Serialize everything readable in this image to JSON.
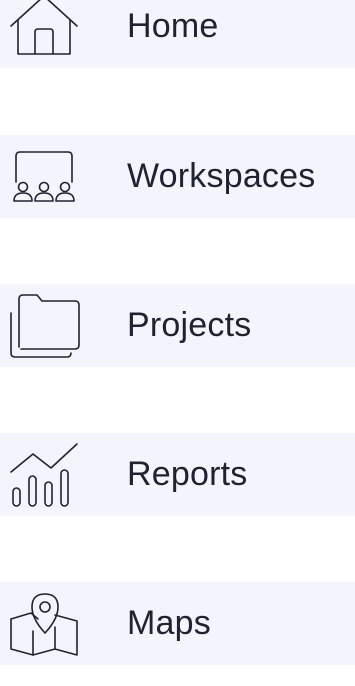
{
  "nav": {
    "background": "#f4f4fd",
    "text_color": "#1f2230",
    "items": [
      {
        "label": "Home",
        "icon": "home-icon"
      },
      {
        "label": "Workspaces",
        "icon": "workspaces-icon"
      },
      {
        "label": "Projects",
        "icon": "folder-icon"
      },
      {
        "label": "Reports",
        "icon": "reports-chart-icon"
      },
      {
        "label": "Maps",
        "icon": "map-pin-icon"
      }
    ]
  }
}
